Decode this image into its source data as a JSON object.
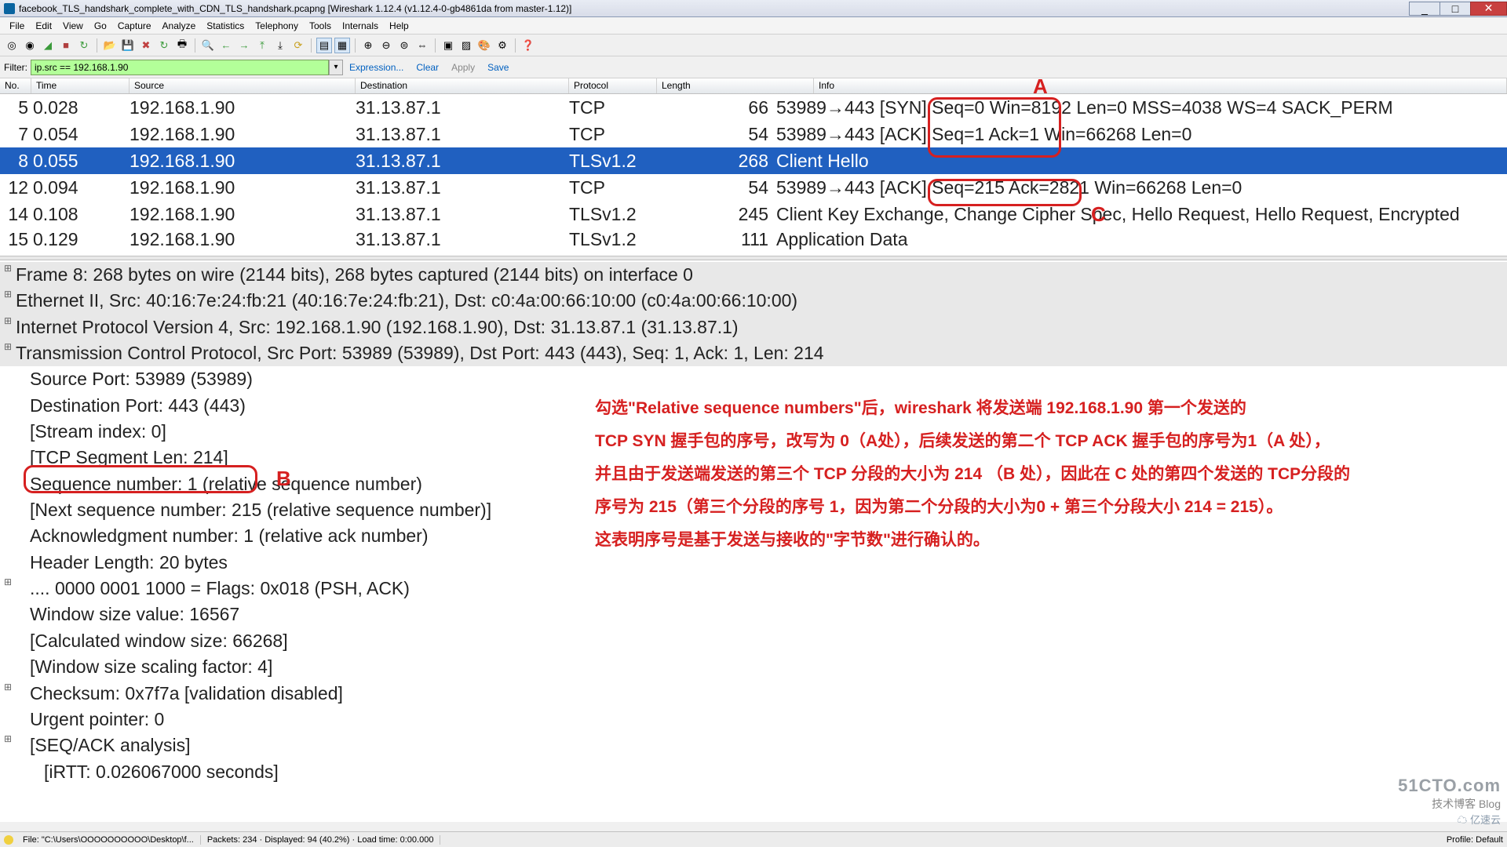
{
  "title_icon": "wireshark",
  "title": "facebook_TLS_handshark_complete_with_CDN_TLS_handshark.pcapng   [Wireshark 1.12.4  (v1.12.4-0-gb4861da from master-1.12)]",
  "menu": [
    "File",
    "Edit",
    "View",
    "Go",
    "Capture",
    "Analyze",
    "Statistics",
    "Telephony",
    "Tools",
    "Internals",
    "Help"
  ],
  "filter_label": "Filter:",
  "filter_value": "ip.src == 192.168.1.90",
  "filter_btns": {
    "expr": "Expression...",
    "clear": "Clear",
    "apply": "Apply",
    "save": "Save"
  },
  "cols": {
    "no": "No.",
    "time": "Time",
    "src": "Source",
    "dst": "Destination",
    "proto": "Protocol",
    "len": "Length",
    "info": "Info"
  },
  "packets": [
    {
      "no": "5",
      "time": "0.028",
      "src": "192.168.1.90",
      "dst": "31.13.87.1",
      "proto": "TCP",
      "len": "66",
      "info": "53989→443 [SYN] Seq=0 Win=8192 Len=0 MSS=4038 WS=4 SACK_PERM"
    },
    {
      "no": "7",
      "time": "0.054",
      "src": "192.168.1.90",
      "dst": "31.13.87.1",
      "proto": "TCP",
      "len": "54",
      "info": "53989→443 [ACK] Seq=1 Ack=1 Win=66268 Len=0"
    },
    {
      "no": "8",
      "time": "0.055",
      "src": "192.168.1.90",
      "dst": "31.13.87.1",
      "proto": "TLSv1.2",
      "len": "268",
      "info": "Client Hello",
      "sel": true
    },
    {
      "no": "12",
      "time": "0.094",
      "src": "192.168.1.90",
      "dst": "31.13.87.1",
      "proto": "TCP",
      "len": "54",
      "info": "53989→443 [ACK] Seq=215 Ack=2821 Win=66268 Len=0"
    },
    {
      "no": "14",
      "time": "0.108",
      "src": "192.168.1.90",
      "dst": "31.13.87.1",
      "proto": "TLSv1.2",
      "len": "245",
      "info": "Client Key Exchange, Change Cipher Spec, Hello Request, Hello Request, Encrypted"
    },
    {
      "no": "15",
      "time": "0.129",
      "src": "192.168.1.90",
      "dst": "31.13.87.1",
      "proto": "TLSv1.2",
      "len": "111",
      "info": "Application Data"
    }
  ],
  "details": {
    "frame": "Frame 8: 268 bytes on wire (2144 bits), 268 bytes captured (2144 bits) on interface 0",
    "eth": "Ethernet II, Src: 40:16:7e:24:fb:21 (40:16:7e:24:fb:21), Dst: c0:4a:00:66:10:00 (c0:4a:00:66:10:00)",
    "ip": "Internet Protocol Version 4, Src: 192.168.1.90 (192.168.1.90), Dst: 31.13.87.1 (31.13.87.1)",
    "tcp": "Transmission Control Protocol, Src Port: 53989 (53989), Dst Port: 443 (443), Seq: 1, Ack: 1, Len: 214",
    "srcport": "Source Port: 53989 (53989)",
    "dstport": "Destination Port: 443 (443)",
    "stream": "[Stream index: 0]",
    "seglen": "[TCP Segment Len: 214]",
    "seqnum": "Sequence number: 1    (relative sequence number)",
    "nextseq": "[Next sequence number: 215    (relative sequence number)]",
    "acknum": "Acknowledgment number: 1    (relative ack number)",
    "hdrlen": "Header Length: 20 bytes",
    "flags": ".... 0000 0001 1000 = Flags: 0x018 (PSH, ACK)",
    "winsize": "Window size value: 16567",
    "calcwin": "[Calculated window size: 66268]",
    "winscale": "[Window size scaling factor: 4]",
    "cksum": "Checksum: 0x7f7a [validation disabled]",
    "urgent": "Urgent pointer: 0",
    "seqack": "[SEQ/ACK analysis]",
    "irtt": "[iRTT: 0.026067000 seconds]"
  },
  "status": {
    "file": "File: \"C:\\Users\\OOOOOOOOOO\\Desktop\\f...",
    "pkts": "Packets: 234 · Displayed: 94 (40.2%) · Load time: 0:00.000",
    "profile": "Profile: Default"
  },
  "annotations": {
    "A": "A",
    "B": "B",
    "C": "C",
    "text": "勾选\"Relative sequence numbers\"后，wireshark 将发送端 192.168.1.90 第一个发送的\nTCP SYN 握手包的序号，改写为 0（A处），后续发送的第二个 TCP ACK 握手包的序号为1（A 处），\n并且由于发送端发送的第三个 TCP 分段的大小为 214 （B 处），因此在 C 处的第四个发送的 TCP分段的\n序号为 215（第三个分段的序号 1，因为第二个分段的大小为0 + 第三个分段大小 214 = 215）。\n这表明序号是基于发送与接收的\"字节数\"进行确认的。"
  },
  "watermark": {
    "big": "51CTO.com",
    "sm": "技术博客  Blog",
    "st": "☁ 亿速云"
  }
}
